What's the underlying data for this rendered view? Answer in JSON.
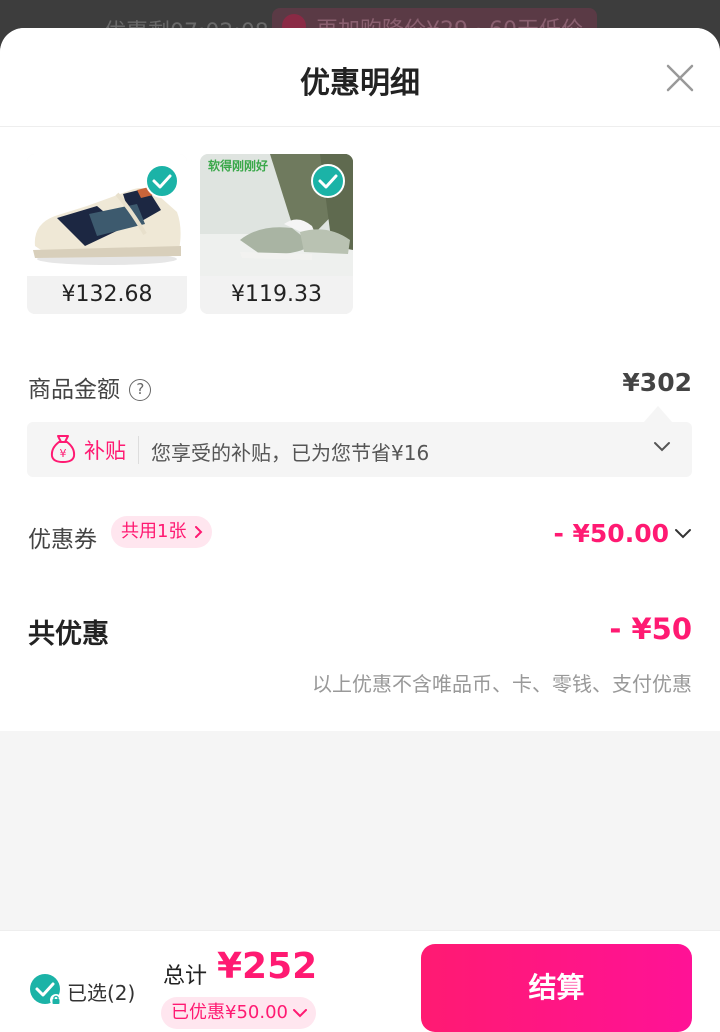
{
  "background": {
    "countdown_text": "优惠剩07:02:08",
    "banner_text": "再加购降价¥29 · 60天低价"
  },
  "sheet": {
    "title": "优惠明细",
    "close_icon": "close-icon"
  },
  "products": [
    {
      "price": "¥132.68",
      "selected": true,
      "image": "sneaker-navy-beige"
    },
    {
      "price": "¥119.33",
      "selected": true,
      "image": "sneaker-on-foot-green",
      "image_caption": "软得刚刚好"
    }
  ],
  "goods_amount": {
    "label": "商品金额",
    "help_icon": "question-icon",
    "value": "¥302"
  },
  "subsidy": {
    "icon": "money-bag-icon",
    "tag": "补贴",
    "description": "您享受的补贴，已为您节省¥16"
  },
  "coupon": {
    "label": "优惠券",
    "pill": "共用1张",
    "amount": "- ¥50.00"
  },
  "total_discount": {
    "label": "共优惠",
    "amount": "- ¥50",
    "note": "以上优惠不含唯品币、卡、零钱、支付优惠"
  },
  "footer": {
    "selected_text": "已选(2)",
    "total_label": "总计",
    "total_amount": "¥252",
    "saved_text": "已优惠¥50.00",
    "checkout_label": "结算"
  },
  "colors": {
    "accent": "#ff1a72",
    "check": "#1bb3a7",
    "pill_bg": "#ffe6ef"
  }
}
